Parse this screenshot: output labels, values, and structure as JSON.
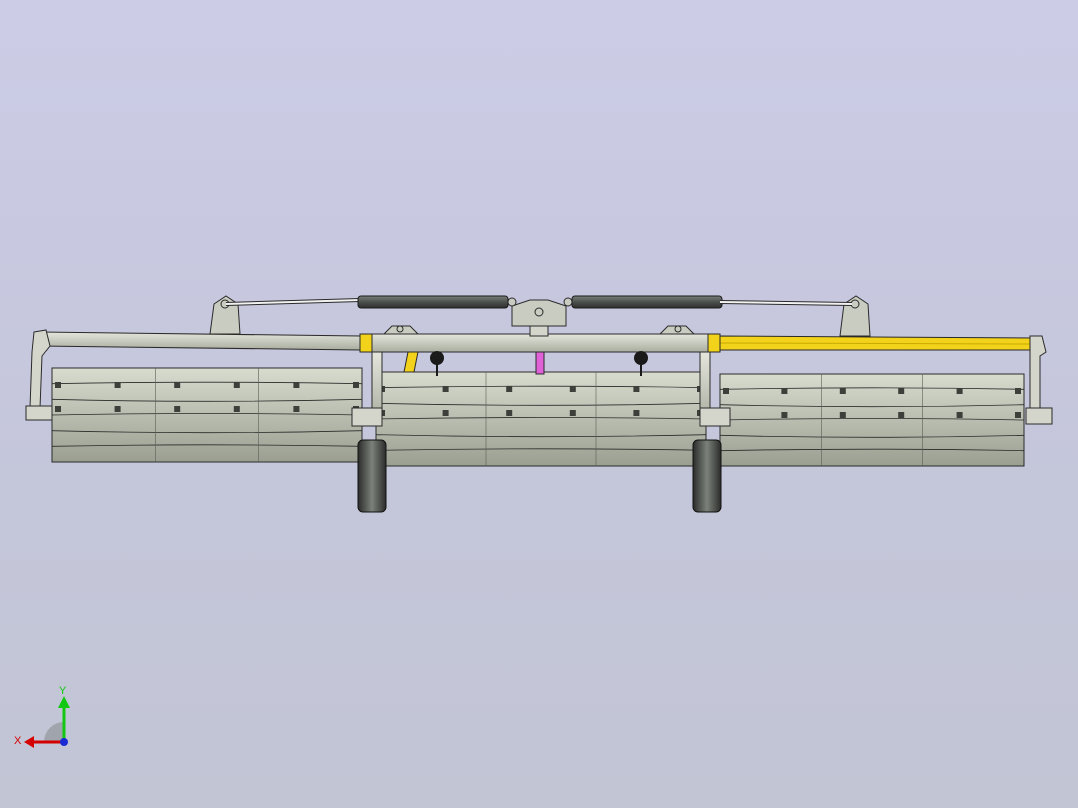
{
  "viewport": {
    "background_top": "#cccce6",
    "background_bottom": "#c2c5d4"
  },
  "model": {
    "frame_color": "#d4d6cc",
    "outline_color": "#1e1e1e",
    "highlight_color": "#f2d21a",
    "cylinder_color": "#555a55",
    "rod_color": "#f2f2f2",
    "tine_color": "#c6cabc",
    "wheel_color": "#3a3d3a",
    "knob_color": "#1a1a1a",
    "accent_pink": "#e060d8"
  },
  "triad": {
    "x_label": "X",
    "y_label": "Y",
    "x_color": "#d40000",
    "y_color": "#12c812",
    "z_color": "#1a2ad4"
  }
}
